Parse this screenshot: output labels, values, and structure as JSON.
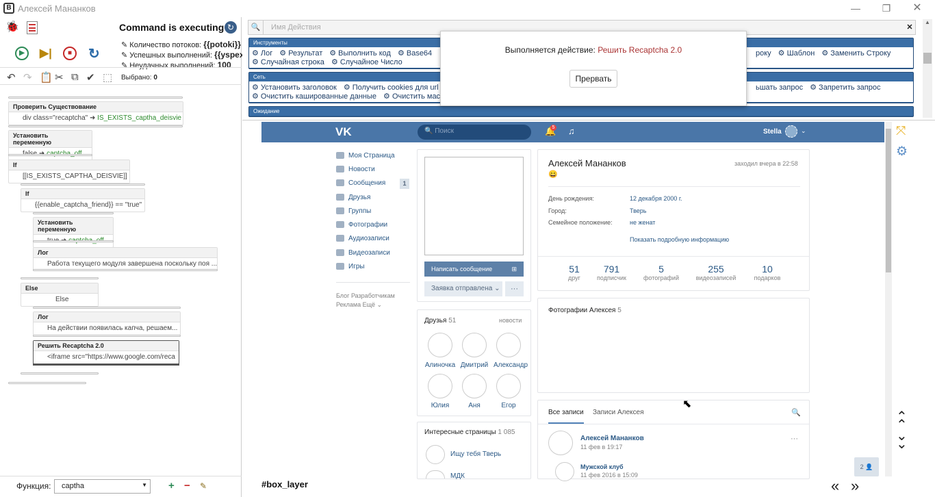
{
  "window": {
    "title": "Алексей Мананков"
  },
  "status": {
    "executing": "Command is executing",
    "threads_label": "Количество потоков:",
    "threads_value": "{{potoki}}",
    "success_label": "Успешных выполнений:",
    "success_value": "{{yspex}}",
    "fail_label": "Неудачных выполнений:",
    "fail_value": "100",
    "selected_label": "Выбрано:",
    "selected_value": "0"
  },
  "nodes": {
    "n1": {
      "title": "Проверить Существование",
      "body_a": "div class=\"recaptcha\"",
      "body_b": "IS_EXISTS_captha_deisvie"
    },
    "n2": {
      "title": "Установить переменную",
      "body_a": "false",
      "body_b": "captcha_off"
    },
    "n3": {
      "title": "If",
      "body": "[[IS_EXISTS_CAPTHA_DEISVIE]]"
    },
    "n4": {
      "title": "If",
      "body": "{{enable_captcha_friend}} == \"true\""
    },
    "n5": {
      "title": "Установить переменную",
      "body_a": "true",
      "body_b": "captcha_off"
    },
    "n6": {
      "title": "Лог",
      "body": "Работа текущего модуля завершена поскольку поя ..."
    },
    "n7": {
      "title": "Else",
      "body": "Else"
    },
    "n8": {
      "title": "Лог",
      "body": "На действии появилась капча, решаем..."
    },
    "n9": {
      "title": "Решить Recaptcha 2.0",
      "body": "<iframe src=\"https://www.google.com/reca"
    }
  },
  "func": {
    "label": "Функция:",
    "value": "captha"
  },
  "search": {
    "placeholder": "Имя Действия"
  },
  "panels": {
    "tools": {
      "header": "Инструменты",
      "row1": [
        "Лог",
        "Результат",
        "Выполнить код",
        "Base64"
      ],
      "row1b": [
        "року",
        "Шаблон",
        "Заменить Строку"
      ],
      "row2": [
        "Случайная строка",
        "Случайное Число"
      ]
    },
    "net": {
      "header": "Сеть",
      "row1": [
        "Установить заголовок",
        "Получить cookies для url"
      ],
      "row1b": [
        "ьшать запрос",
        "Запретить запрос"
      ],
      "row2": [
        "Очистить кашированные данные",
        "Очистить маски"
      ]
    },
    "wait": {
      "header": "Ожидание"
    }
  },
  "modal": {
    "text": "Выполняется действие:",
    "action": "Решить Recaptcha 2.0",
    "button": "Прервать"
  },
  "vk": {
    "search_placeholder": "Поиск",
    "notif_count": "5",
    "user": "Stella",
    "menu": [
      "Моя Страница",
      "Новости",
      "Сообщения",
      "Друзья",
      "Группы",
      "Фотографии",
      "Аудиозаписи",
      "Видеозаписи",
      "Игры"
    ],
    "messages_count": "1",
    "footer1": "Блог   Разработчикам",
    "footer2": "Реклама   Ещё ⌄",
    "write_msg": "Написать сообщение",
    "request_sent": "Заявка отправлена ⌄",
    "more": "···",
    "friends_title": "Друзья",
    "friends_count": "51",
    "friends_news": "новости",
    "friends": [
      "Алиночка",
      "Дмитрий",
      "Александр",
      "Юлия",
      "Аня",
      "Егор"
    ],
    "interesting": "Интересные страницы",
    "interesting_count": "1 085",
    "page1": "Ищу тебя Тверь",
    "page2": "МДК",
    "name": "Алексей Мананков",
    "online": "заходил вчера в 22:58",
    "emoji": "😄",
    "birthday_label": "День рождения:",
    "birthday": "12 декабря 2000 г.",
    "city_label": "Город:",
    "city": "Тверь",
    "family_label": "Семейное положение:",
    "family": "не женат",
    "more_info": "Показать подробную информацию",
    "counters": [
      {
        "n": "51",
        "l": "друг"
      },
      {
        "n": "791",
        "l": "подписчик"
      },
      {
        "n": "5",
        "l": "фотографий"
      },
      {
        "n": "255",
        "l": "видеозаписей"
      },
      {
        "n": "10",
        "l": "подарков"
      }
    ],
    "photos_title": "Фотографии Алексея",
    "photos_count": "5",
    "tab_all": "Все записи",
    "tab_his": "Записи Алексея",
    "post_author": "Алексей Мананков",
    "post_date": "11 фев в 19:17",
    "repost_author": "Мужской клуб",
    "repost_date": "11 фев 2016 в 15:09",
    "side_badge": "2 👤"
  },
  "box_layer": "#box_layer"
}
